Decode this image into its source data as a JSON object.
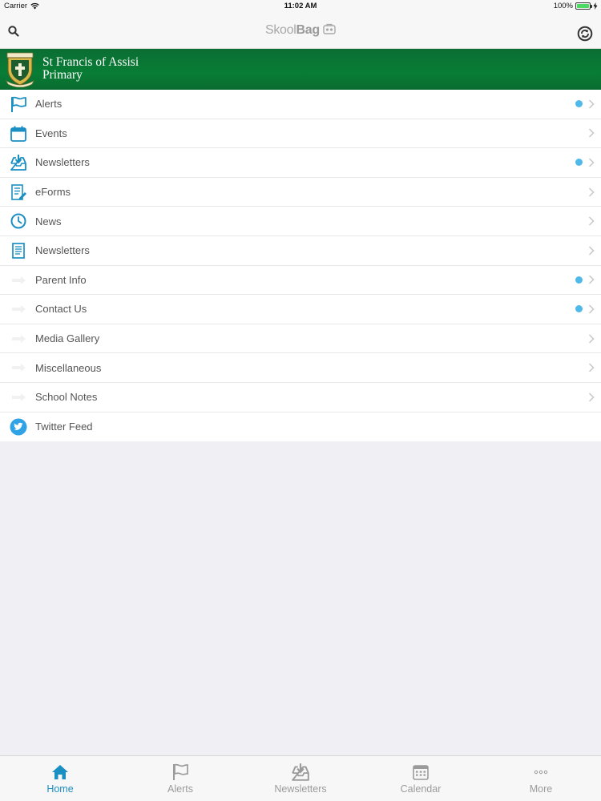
{
  "status_bar": {
    "carrier": "Carrier",
    "time": "11:02 AM",
    "battery": "100%",
    "battery_color": "#4cd964"
  },
  "nav_bar": {
    "brand_light": "Skool",
    "brand_bold": "Bag",
    "search_icon": "search-icon",
    "sync_icon": "sync-icon"
  },
  "school": {
    "name_line1": "St Francis of Assisi",
    "name_line2": "Primary",
    "banner_color": "#087d35"
  },
  "accent_color": "#1a8fc4",
  "unread_dot_color": "#4fb9ea",
  "menu": {
    "items": [
      {
        "label": "Alerts",
        "icon": "flag-icon",
        "has_dot": true
      },
      {
        "label": "Events",
        "icon": "calendar-icon",
        "has_dot": false
      },
      {
        "label": "Newsletters",
        "icon": "inbox-download-icon",
        "has_dot": true
      },
      {
        "label": "eForms",
        "icon": "form-edit-icon",
        "has_dot": false
      },
      {
        "label": "News",
        "icon": "clock-icon",
        "has_dot": false
      },
      {
        "label": "Newsletters",
        "icon": "document-icon",
        "has_dot": false
      },
      {
        "label": "Parent Info",
        "icon": "arrow-placeholder-icon",
        "has_dot": true
      },
      {
        "label": "Contact Us",
        "icon": "arrow-placeholder-icon",
        "has_dot": true
      },
      {
        "label": "Media Gallery",
        "icon": "arrow-placeholder-icon",
        "has_dot": false
      },
      {
        "label": "Miscellaneous",
        "icon": "arrow-placeholder-icon",
        "has_dot": false
      },
      {
        "label": "School Notes",
        "icon": "arrow-placeholder-icon",
        "has_dot": false
      },
      {
        "label": "Twitter Feed",
        "icon": "twitter-bird-icon",
        "has_dot": false
      }
    ]
  },
  "tab_bar": {
    "active_color": "#1a8fc4",
    "inactive_color": "#9b9b9b",
    "tabs": [
      {
        "label": "Home",
        "icon": "home-icon",
        "active": true
      },
      {
        "label": "Alerts",
        "icon": "flag-icon",
        "active": false
      },
      {
        "label": "Newsletters",
        "icon": "inbox-download-icon",
        "active": false
      },
      {
        "label": "Calendar",
        "icon": "calendar-icon",
        "active": false
      },
      {
        "label": "More",
        "icon": "more-dots-icon",
        "active": false
      }
    ]
  }
}
